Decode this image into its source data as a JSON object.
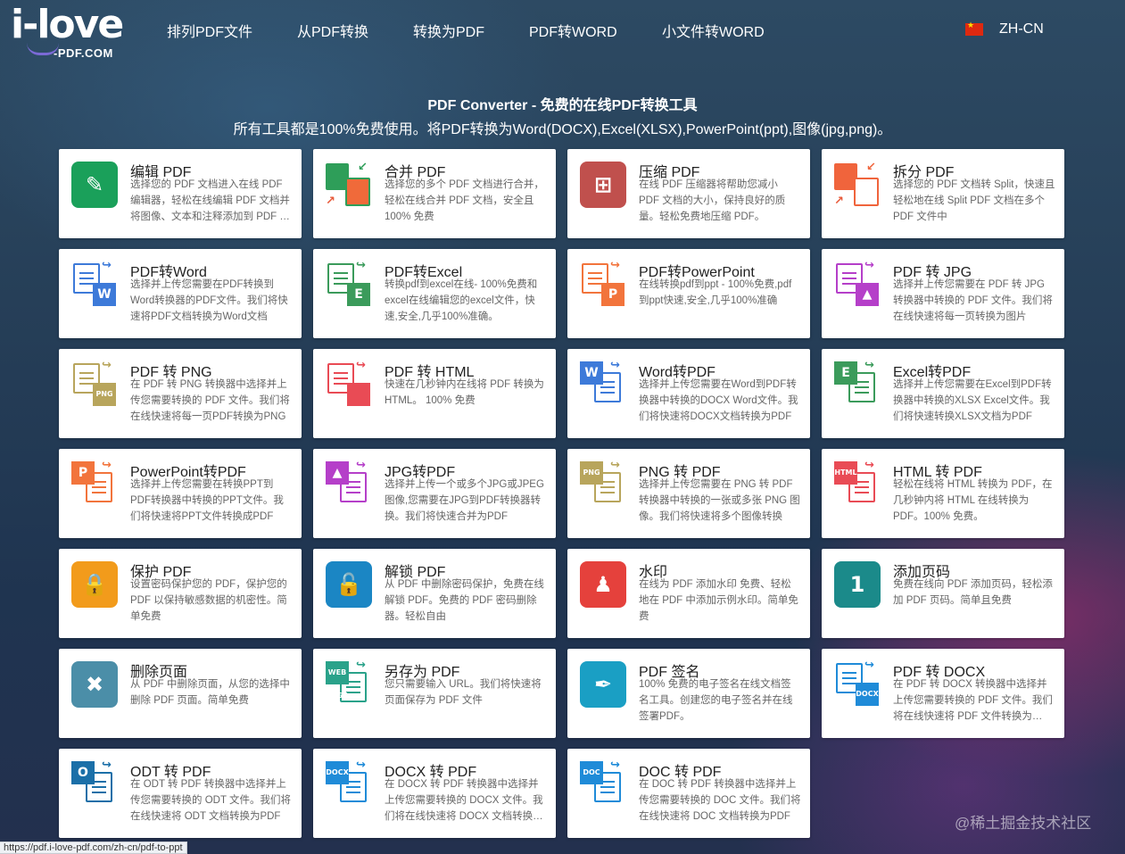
{
  "logo": {
    "main": "i-love",
    "sub": "-PDF.COM"
  },
  "nav": [
    {
      "label": "排列PDF文件"
    },
    {
      "label": "从PDF转换"
    },
    {
      "label": "转换为PDF"
    },
    {
      "label": "PDF转WORD"
    },
    {
      "label": "小文件转WORD"
    }
  ],
  "language": {
    "label": "ZH-CN",
    "flag": "china-flag-icon"
  },
  "intro": {
    "title": "PDF Converter - 免费的在线PDF转换工具",
    "subtitle": "所有工具都是100%免费使用。将PDF转换为Word(DOCX),Excel(XLSX),PowerPoint(ppt),图像(jpg,png)。"
  },
  "tools": [
    {
      "title": "编辑 PDF",
      "desc": "选择您的 PDF 文档进入在线 PDF 编辑器，轻松在线编辑 PDF 文档并将图像、文本和注释添加到 PDF 文件",
      "icon": "edit-pdf-icon",
      "color": "#1aa05a"
    },
    {
      "title": "合并 PDF",
      "desc": "选择您的多个 PDF 文档进行合并，轻松在线合并 PDF 文档，安全且 100% 免费",
      "icon": "merge-pdf-icon",
      "color": "#2e9e59"
    },
    {
      "title": "压缩 PDF",
      "desc": "在线 PDF 压缩器将帮助您减小 PDF 文档的大小，保持良好的质量。轻松免费地压缩 PDF。",
      "icon": "compress-pdf-icon",
      "color": "#c0504d"
    },
    {
      "title": "拆分 PDF",
      "desc": "选择您的 PDF 文档转 Split，快速且轻松地在线 Split PDF 文档在多个 PDF 文件中",
      "icon": "split-pdf-icon",
      "color": "#f0643c"
    },
    {
      "title": "PDF转Word",
      "desc": "选择并上传您需要在PDF转换到Word转换器的PDF文件。我们将快速将PDF文档转换为Word文档",
      "icon": "pdf-to-word-icon",
      "color": "#3d7ad9"
    },
    {
      "title": "PDF转Excel",
      "desc": "转换pdf到excel在线- 100%免费和excel在线编辑您的excel文件，快速,安全,几乎100%准确。",
      "icon": "pdf-to-excel-icon",
      "color": "#3b9b5b"
    },
    {
      "title": "PDF转PowerPoint",
      "desc": "在线转换pdf到ppt - 100%免费,pdf到ppt快速,安全,几乎100%准确",
      "icon": "pdf-to-powerpoint-icon",
      "color": "#f2743c"
    },
    {
      "title": "PDF 转 JPG",
      "desc": "选择并上传您需要在 PDF 转 JPG 转换器中转换的 PDF 文件。我们将在线快速将每一页转换为图片",
      "icon": "pdf-to-jpg-icon",
      "color": "#b53fc9"
    },
    {
      "title": "PDF 转 PNG",
      "desc": "在 PDF 转 PNG 转换器中选择并上传您需要转换的 PDF 文件。我们将在线快速将每一页PDF转换为PNG",
      "icon": "pdf-to-png-icon",
      "color": "#b8a55c"
    },
    {
      "title": "PDF 转 HTML",
      "desc": "快速在几秒钟内在线将 PDF 转换为 HTML。 100% 免费",
      "icon": "pdf-to-html-icon",
      "color": "#e94b55"
    },
    {
      "title": "Word转PDF",
      "desc": "选择并上传您需要在Word到PDF转换器中转换的DOCX Word文件。我们将快速将DOCX文档转换为PDF",
      "icon": "word-to-pdf-icon",
      "color": "#3d7ad9"
    },
    {
      "title": "Excel转PDF",
      "desc": "选择并上传您需要在Excel到PDF转换器中转换的XLSX Excel文件。我们将快速转换XLSX文档为PDF",
      "icon": "excel-to-pdf-icon",
      "color": "#3b9b5b"
    },
    {
      "title": "PowerPoint转PDF",
      "desc": "选择并上传您需要在转换PPT到PDF转换器中转换的PPT文件。我们将快速将PPT文件转换成PDF",
      "icon": "powerpoint-to-pdf-icon",
      "color": "#f2743c"
    },
    {
      "title": "JPG转PDF",
      "desc": "选择并上传一个或多个JPG或JPEG图像,您需要在JPG到PDF转换器转换。我们将快速合并为PDF",
      "icon": "jpg-to-pdf-icon",
      "color": "#b53fc9"
    },
    {
      "title": "PNG 转 PDF",
      "desc": "选择并上传您需要在 PNG 转 PDF 转换器中转换的一张或多张 PNG 图像。我们将快速将多个图像转换",
      "icon": "png-to-pdf-icon",
      "color": "#b8a55c"
    },
    {
      "title": "HTML 转 PDF",
      "desc": "轻松在线将 HTML 转换为 PDF，在几秒钟内将 HTML 在线转换为 PDF。100% 免费。",
      "icon": "html-to-pdf-icon",
      "color": "#e94b55"
    },
    {
      "title": "保护 PDF",
      "desc": "设置密码保护您的 PDF，保护您的 PDF 以保持敏感数据的机密性。简单免费",
      "icon": "protect-pdf-icon",
      "color": "#f29b1b"
    },
    {
      "title": "解锁 PDF",
      "desc": "从 PDF 中删除密码保护，免费在线解锁 PDF。免费的 PDF 密码删除器。轻松自由",
      "icon": "unlock-pdf-icon",
      "color": "#1b86c4"
    },
    {
      "title": "水印",
      "desc": "在线为 PDF 添加水印 免费、轻松地在 PDF 中添加示例水印。简单免费",
      "icon": "watermark-icon",
      "color": "#e5413c"
    },
    {
      "title": "添加页码",
      "desc": "免费在线向 PDF 添加页码，轻松添加 PDF 页码。简单且免费",
      "icon": "add-page-numbers-icon",
      "color": "#1b8a8a"
    },
    {
      "title": "删除页面",
      "desc": "从 PDF 中删除页面，从您的选择中删除 PDF 页面。简单免费",
      "icon": "delete-pages-icon",
      "color": "#4b8ea8"
    },
    {
      "title": "另存为 PDF",
      "desc": "您只需要输入 URL。我们将快速将页面保存为 PDF 文件",
      "icon": "save-as-pdf-icon",
      "color": "#2aa28a"
    },
    {
      "title": "PDF 签名",
      "desc": "100% 免费的电子签名在线文档签名工具。创建您的电子签名并在线签署PDF。",
      "icon": "sign-pdf-icon",
      "color": "#1a9fc4"
    },
    {
      "title": "PDF 转 DOCX",
      "desc": "在 PDF 转 DOCX 转换器中选择并上传您需要转换的 PDF 文件。我们将在线快速将 PDF 文件转换为DOCX",
      "icon": "pdf-to-docx-icon",
      "color": "#1f8bd8"
    },
    {
      "title": "ODT 转 PDF",
      "desc": "在 ODT 转 PDF 转换器中选择并上传您需要转换的 ODT 文件。我们将在线快速将 ODT 文档转换为PDF",
      "icon": "odt-to-pdf-icon",
      "color": "#1b6fa8"
    },
    {
      "title": "DOCX 转 PDF",
      "desc": "在 DOCX 转 PDF 转换器中选择并上传您需要转换的 DOCX 文件。我们将在线快速将 DOCX 文档转换为PDF",
      "icon": "docx-to-pdf-icon",
      "color": "#1f8bd8"
    },
    {
      "title": "DOC 转 PDF",
      "desc": "在 DOC 转 PDF 转换器中选择并上传您需要转换的 DOC 文件。我们将在线快速将 DOC 文档转换为PDF",
      "icon": "doc-to-pdf-icon",
      "color": "#1f8bd8"
    }
  ],
  "status_url": "https://pdf.i-love-pdf.com/zh-cn/pdf-to-ppt",
  "watermark": "@稀土掘金技术社区"
}
